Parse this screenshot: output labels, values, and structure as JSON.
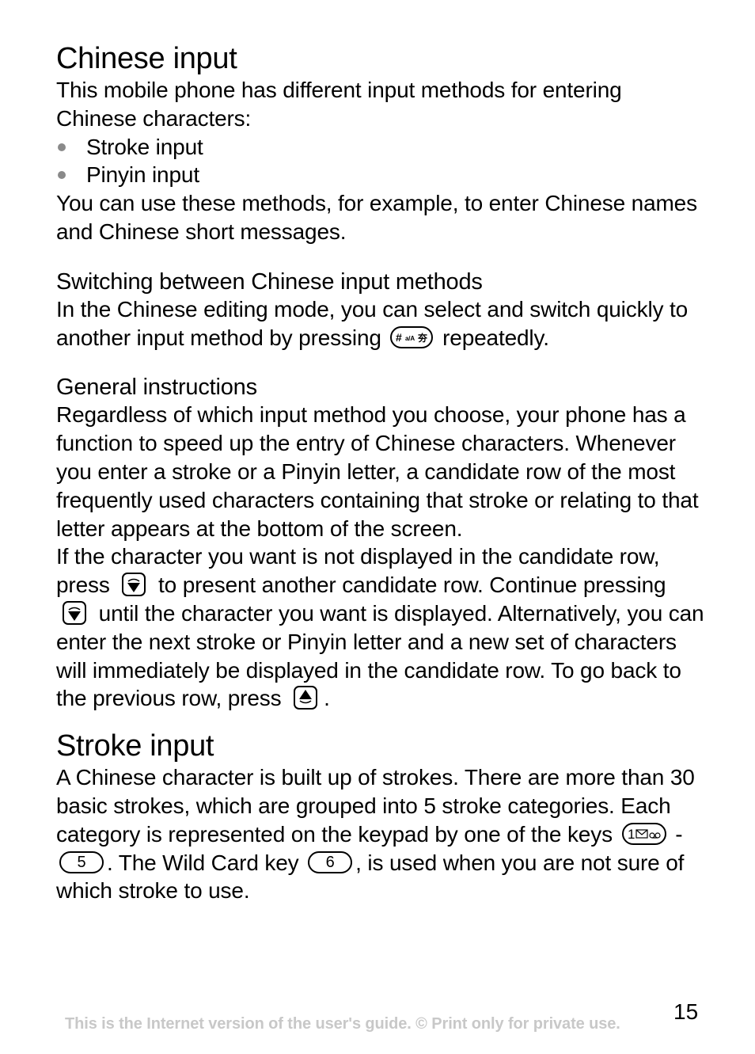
{
  "section1": {
    "title": "Chinese input",
    "intro": "This mobile phone has different input methods for entering Chinese characters:",
    "bullets": [
      "Stroke input",
      "Pinyin input"
    ],
    "outro": "You can use these methods, for example, to enter Chinese names and Chinese short messages."
  },
  "switching": {
    "heading": "Switching between Chinese input methods",
    "text_before": "In the Chinese editing mode, you can select and switch quickly to another input method by pressing",
    "key_icon": "hash-key-icon",
    "key_label": "# a/A 夯",
    "text_after": "repeatedly."
  },
  "general": {
    "heading": "General instructions",
    "para1": "Regardless of which input method you choose, your phone has a function to speed up the entry of Chinese characters. Whenever you enter a stroke or a Pinyin letter, a candidate row of the most frequently used characters containing that stroke or relating to that letter appears at the bottom of the screen.",
    "para2_part1": "If the character you want is not displayed in the candidate row, press",
    "para2_part2": "to present another candidate row. Continue pressing",
    "para2_part3": "until the character you want is displayed. Alternatively, you can enter the next stroke or Pinyin letter and a new set of characters will immediately be displayed in the candidate row. To go back to the previous row, press",
    "para2_end": ".",
    "down_key_icon": "navigation-down-key-icon",
    "up_key_icon": "navigation-up-key-icon"
  },
  "section2": {
    "title": "Stroke input",
    "text_part1": "A Chinese character is built up of strokes. There are more than 30 basic strokes, which are grouped into 5 stroke categories. Each category is represented on the keypad by one of the keys",
    "key1_label": "1",
    "key1_icon": "voicemail-key-icon",
    "dash": "-",
    "key5_label": "5",
    "text_part2": ". The Wild Card key",
    "key6_label": "6",
    "text_part3": ", is used when you are not sure of which stroke to use."
  },
  "footer": {
    "notice": "This is the Internet version of the user's guide. © Print only for private use.",
    "page_number": "15"
  }
}
